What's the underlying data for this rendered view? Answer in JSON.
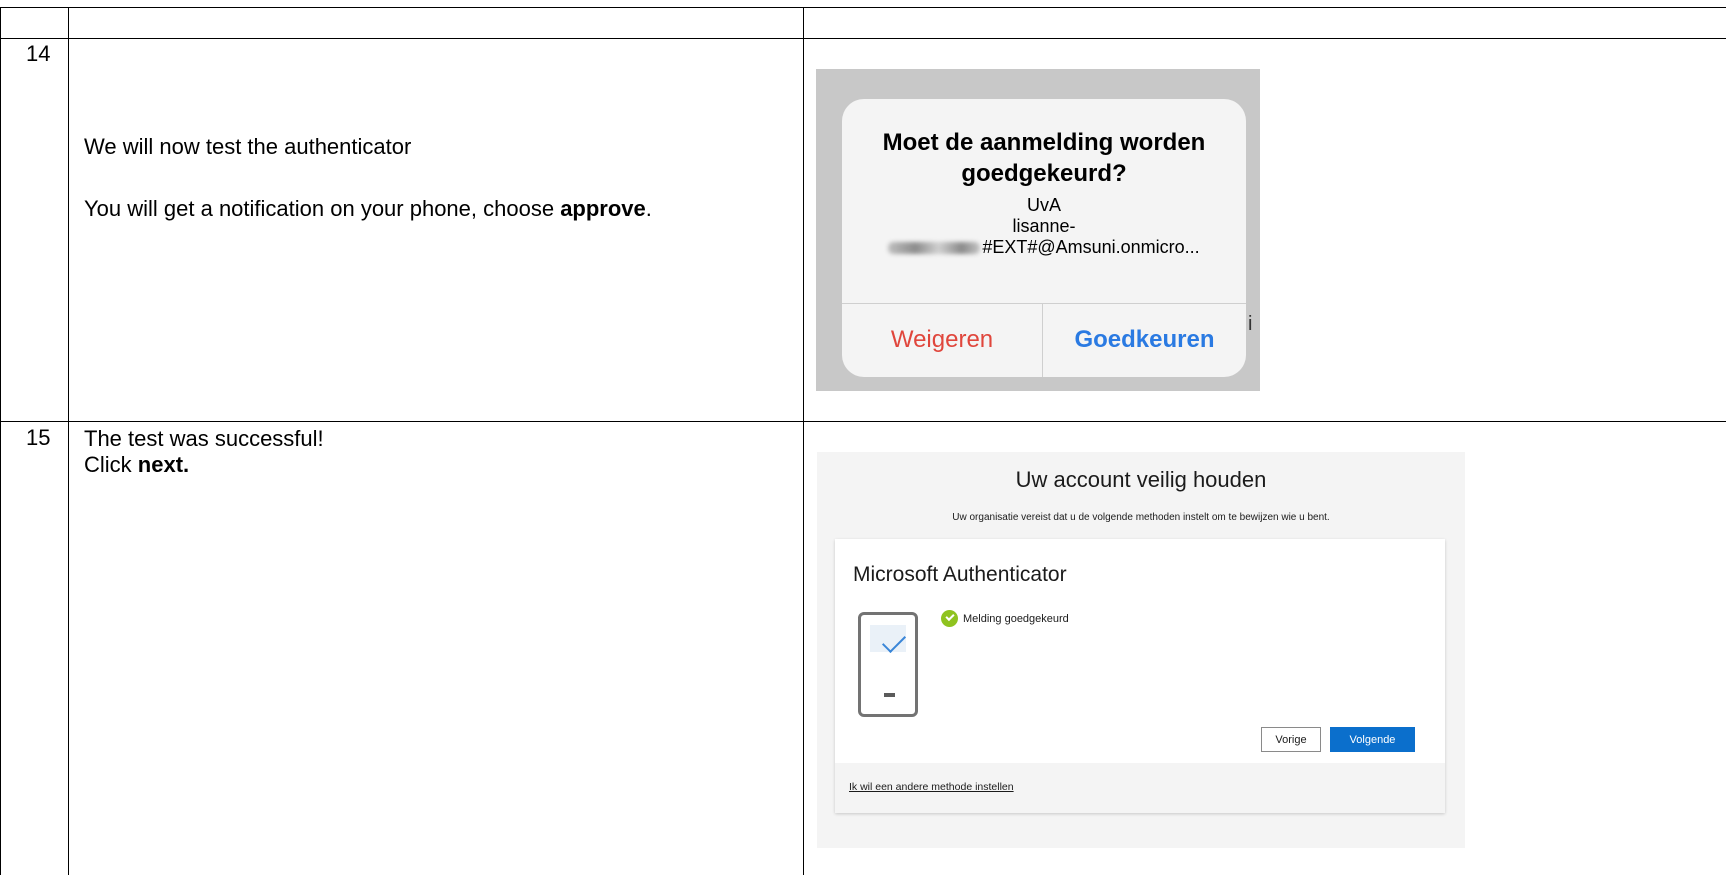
{
  "rows": [
    {
      "number": "14",
      "instruction_line1": "We will now test the authenticator",
      "instruction_line2_pre": "You will get a notification on your phone, choose ",
      "instruction_line2_bold": "approve",
      "instruction_line2_post": ".",
      "screenshot": {
        "title_line1": "Moet de aanmelding worden",
        "title_line2": "goedgekeurd?",
        "org": "UvA",
        "user_line1": "lisanne-",
        "user_line2": "#EXT#@Amsuni.onmicro...",
        "deny_label": "Weigeren",
        "approve_label": "Goedkeuren",
        "stray_char": "i"
      }
    },
    {
      "number": "15",
      "instruction_line1": "The test was successful!",
      "instruction_line2_pre": "Click ",
      "instruction_line2_bold": "next.",
      "screenshot": {
        "title": "Uw account veilig houden",
        "subtitle": "Uw organisatie vereist dat u de volgende methoden instelt om te bewijzen wie u bent.",
        "card_heading": "Microsoft Authenticator",
        "status_text": "Melding goedgekeurd",
        "back_label": "Vorige",
        "next_label": "Volgende",
        "alt_method_link": "Ik wil een andere methode instellen"
      }
    }
  ],
  "colors": {
    "deny": "#e0463c",
    "approve": "#2a7ae2",
    "primary_button": "#0b6fcc",
    "success": "#8fc31f"
  },
  "icons": [
    "phone-icon",
    "checkmark-icon",
    "success-check-icon"
  ]
}
